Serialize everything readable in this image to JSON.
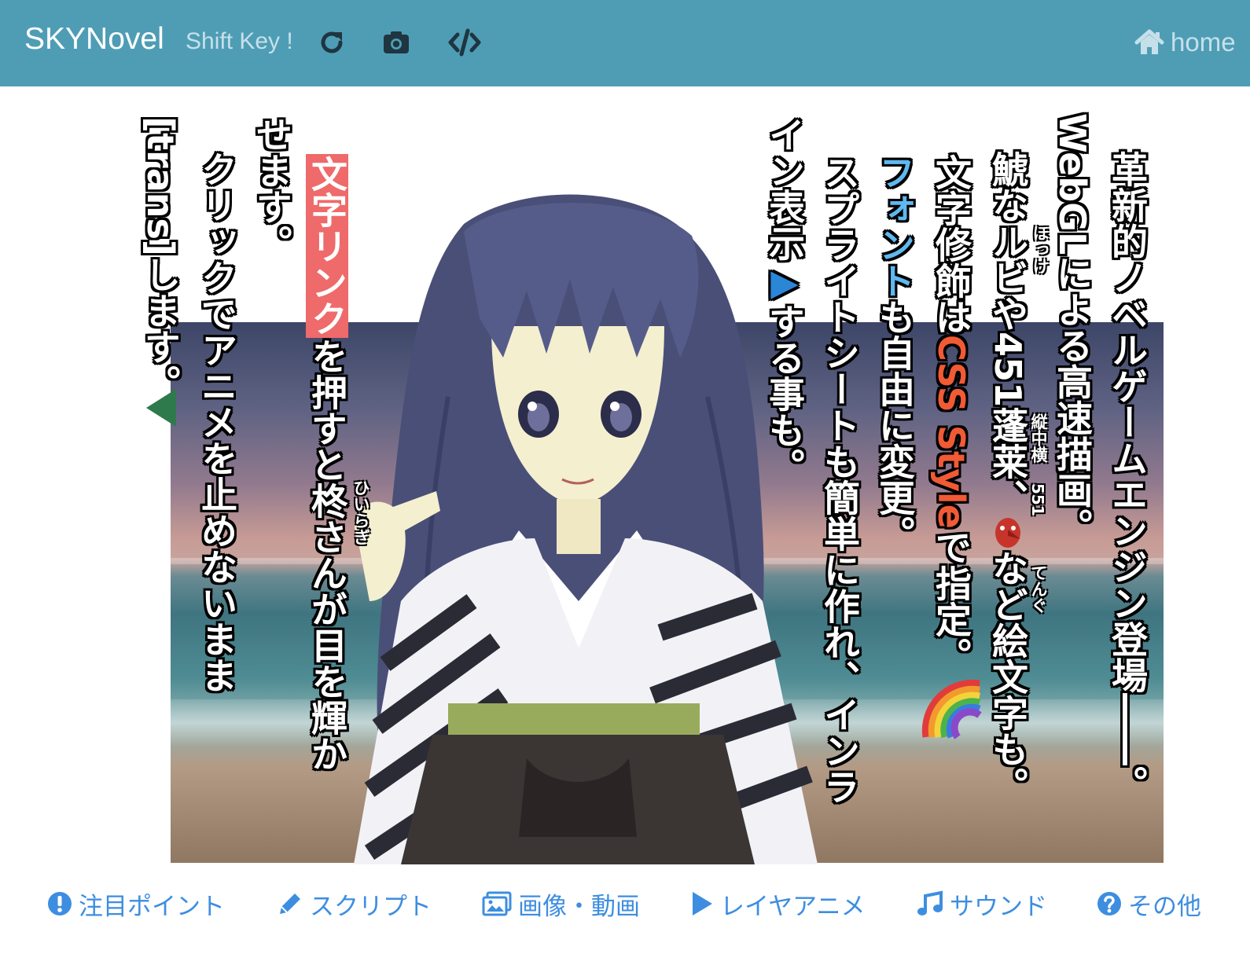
{
  "navbar": {
    "brand": "SKYNovel",
    "shift_label": "Shift Key !",
    "icons": [
      "reload-icon",
      "camera-icon",
      "code-icon"
    ],
    "home_label": "home",
    "colors": {
      "background": "#4e9db5",
      "text": "#ffffff",
      "muted": "#c6e0ea"
    }
  },
  "stage": {
    "columns": [
      {
        "parts": [
          "革新的ノベルゲームエンジン登場――。"
        ]
      },
      {
        "parts": [
          "WebGLによる高速描画。"
        ]
      },
      {
        "parts": [
          "鯱なルビや",
          "451",
          "蓬莱",
          "、",
          "など絵文字も。"
        ],
        "ruby_hokke": "ほっけ",
        "tate_chu_yoko": "縦中横",
        "digits": "551",
        "ruby_tengu": "てんぐ"
      },
      {
        "parts": [
          "文字修飾は",
          "CSS Style",
          "で指定。"
        ]
      },
      {
        "parts": [
          "フォント",
          "も自由に変更。"
        ]
      },
      {
        "parts": [
          "スプライトシートも簡単に作れ、インラ"
        ]
      },
      {
        "parts": [
          "イン表示",
          "▶",
          "する事も。"
        ]
      },
      {
        "parts": [
          "文字リンク",
          "を押すと",
          "柊",
          "さんが目を輝か"
        ],
        "ruby_hiiragi": "ひいらぎ"
      },
      {
        "parts": [
          "せます。"
        ]
      },
      {
        "parts": [
          "クリックでアニメを止めないまま"
        ]
      },
      {
        "parts": [
          "[trans]します。"
        ]
      }
    ],
    "colors": {
      "highlight": "#ef6a6a",
      "css_red": "#f05a35",
      "font_blue": "#5fb8ef",
      "wait_marker": "#2f7a4d"
    }
  },
  "menu": {
    "items": [
      {
        "icon": "exclamation-circle-icon",
        "label": "注目ポイント"
      },
      {
        "icon": "pencil-icon",
        "label": "スクリプト"
      },
      {
        "icon": "image-icon",
        "label": "画像・動画"
      },
      {
        "icon": "play-icon",
        "label": "レイヤアニメ"
      },
      {
        "icon": "music-icon",
        "label": "サウンド"
      },
      {
        "icon": "question-circle-icon",
        "label": "その他"
      }
    ],
    "color": "#3d8ee0"
  }
}
